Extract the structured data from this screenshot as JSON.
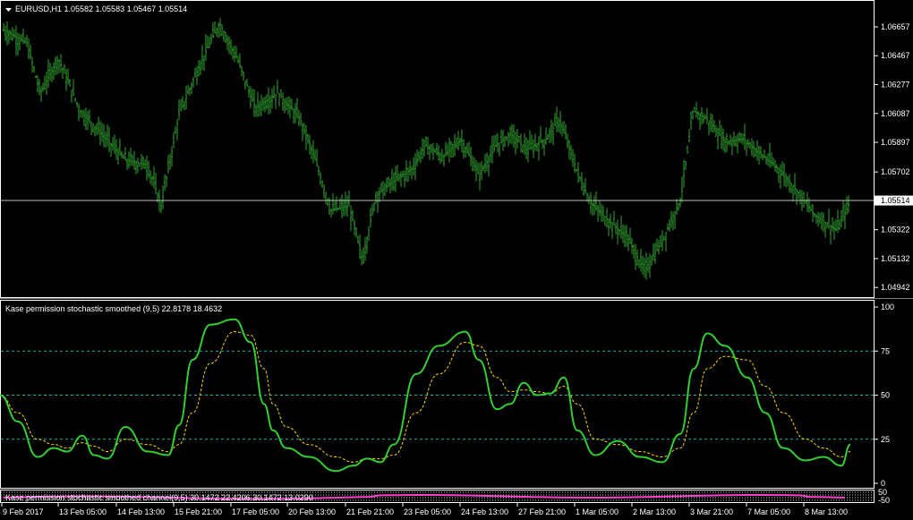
{
  "header": {
    "menu_icon": "triangle-down-icon",
    "main_title": "EURUSD,H1  1.05582 1.05583 1.05467 1.05514",
    "indicator_title": "Kase permission stochastic smoothed (9,5) 22.8178 18.4632",
    "channel_title": "Kase permission stochastic smoothed channel(9,5) 30.1472 22.4206 30.1472 13.0290"
  },
  "colors": {
    "background": "#000000",
    "bars": "#2fa52f",
    "grid_lines": "#ffffff",
    "stoch_main": "#32cd32",
    "stoch_signal": "#ffd700",
    "level_lines": "#20b2aa",
    "channel_line": "#ff3fd0",
    "current_price_line": "#c0c0c0"
  },
  "price_axis": {
    "ticks": [
      "1.06657",
      "1.06467",
      "1.06277",
      "1.06087",
      "1.05897",
      "1.05702",
      "1.05322",
      "1.05132",
      "1.04942"
    ],
    "current_price": "1.05514"
  },
  "indicator_axis": {
    "ticks": [
      "100",
      "75",
      "50",
      "25",
      "0"
    ],
    "levels": [
      75,
      50,
      25
    ]
  },
  "channel_axis": {
    "ticks": [
      "50",
      "-50"
    ]
  },
  "time_axis": {
    "labels": [
      "9 Feb 2017",
      "13 Feb 05:00",
      "14 Feb 13:00",
      "15 Feb 21:00",
      "17 Feb 05:00",
      "20 Feb 13:00",
      "21 Feb 21:00",
      "23 Feb 05:00",
      "24 Feb 13:00",
      "27 Feb 21:00",
      "1 Mar 05:00",
      "2 Mar 13:00",
      "3 Mar 21:00",
      "7 Mar 05:00",
      "8 Mar 13:00"
    ]
  },
  "chart_data": [
    {
      "type": "bar",
      "title": "EURUSD,H1",
      "symbol": "EURUSD",
      "timeframe": "H1",
      "last_bar": {
        "open": 1.05582,
        "high": 1.05583,
        "low": 1.05467,
        "close": 1.05514
      },
      "y_range": [
        1.0489,
        1.0681
      ],
      "close_path_x": [
        0,
        30,
        45,
        65,
        90,
        110,
        140,
        165,
        180,
        200,
        225,
        245,
        265,
        285,
        310,
        335,
        350,
        370,
        390,
        405,
        420,
        435,
        460,
        475,
        495,
        515,
        535,
        555,
        570,
        590,
        610,
        625,
        645,
        660,
        680,
        700,
        720,
        740,
        760,
        775,
        790,
        810,
        830,
        850,
        870,
        890,
        910,
        935,
        950
      ],
      "close_path_y": [
        1.0665,
        1.0655,
        1.0622,
        1.0645,
        1.061,
        1.0598,
        1.0578,
        1.0575,
        1.0548,
        1.0608,
        1.0643,
        1.0668,
        1.0645,
        1.0612,
        1.0622,
        1.0605,
        1.0582,
        1.0545,
        1.0548,
        1.0512,
        1.0555,
        1.0562,
        1.0572,
        1.0588,
        1.058,
        1.0592,
        1.0568,
        1.0588,
        1.0595,
        1.0585,
        1.0592,
        1.0605,
        1.057,
        1.055,
        1.0538,
        1.0528,
        1.0505,
        1.0525,
        1.0552,
        1.061,
        1.0605,
        1.059,
        1.0592,
        1.0582,
        1.0572,
        1.0558,
        1.0542,
        1.0532,
        1.0551
      ]
    },
    {
      "type": "line",
      "title": "Kase permission stochastic smoothed (9,5)",
      "ylim": [
        0,
        100
      ],
      "levels": [
        25,
        50,
        75
      ],
      "x": [
        0,
        20,
        42,
        60,
        75,
        92,
        105,
        120,
        140,
        165,
        188,
        200,
        215,
        235,
        262,
        280,
        295,
        305,
        320,
        345,
        375,
        395,
        410,
        425,
        440,
        465,
        490,
        520,
        535,
        555,
        570,
        585,
        600,
        615,
        630,
        645,
        665,
        690,
        715,
        740,
        760,
        775,
        790,
        810,
        835,
        855,
        875,
        900,
        920,
        940,
        950
      ],
      "series": [
        {
          "name": "main",
          "values": [
            50,
            35,
            15,
            20,
            18,
            27,
            16,
            14,
            32,
            18,
            16,
            33,
            70,
            90,
            93,
            80,
            45,
            30,
            20,
            15,
            7,
            10,
            14,
            12,
            22,
            62,
            78,
            86,
            70,
            42,
            45,
            57,
            50,
            51,
            60,
            30,
            16,
            24,
            15,
            12,
            28,
            65,
            85,
            78,
            60,
            40,
            20,
            13,
            15,
            10,
            22
          ]
        },
        {
          "name": "signal",
          "values": [
            50,
            40,
            25,
            22,
            20,
            23,
            21,
            18,
            25,
            22,
            18,
            22,
            40,
            68,
            86,
            84,
            65,
            45,
            32,
            22,
            15,
            12,
            14,
            14,
            16,
            40,
            62,
            80,
            78,
            60,
            52,
            53,
            52,
            51,
            55,
            45,
            25,
            22,
            18,
            15,
            20,
            40,
            65,
            72,
            70,
            55,
            40,
            25,
            20,
            15,
            18
          ]
        }
      ]
    }
  ]
}
